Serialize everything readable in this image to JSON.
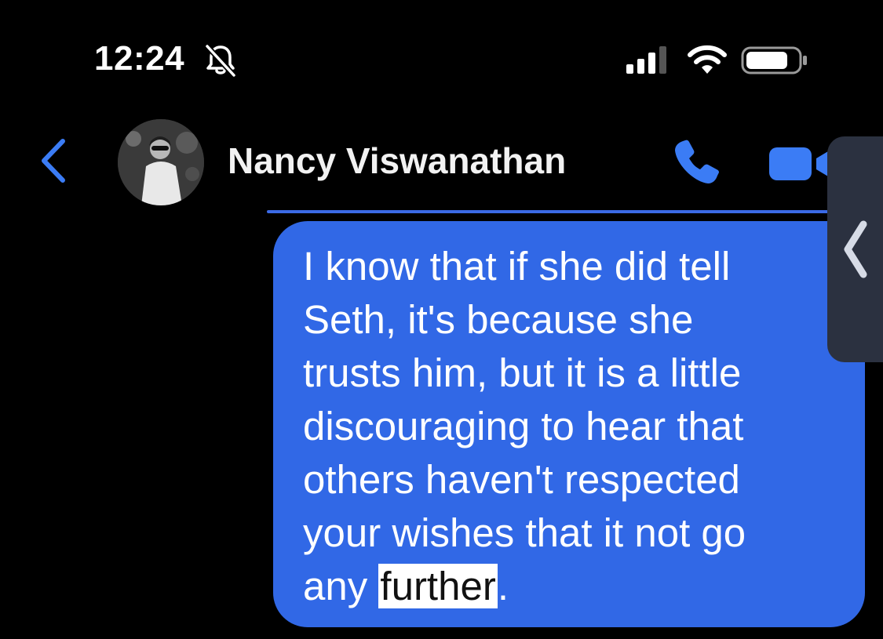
{
  "status_bar": {
    "time": "12:24",
    "bell_icon": "bell-slash-icon",
    "signal_icon": "cellular-signal-icon",
    "wifi_icon": "wifi-icon",
    "battery_icon": "battery-icon"
  },
  "header": {
    "back_icon": "chevron-left-icon",
    "contact_name": "Nancy Viswanathan",
    "phone_icon": "phone-icon",
    "video_icon": "video-camera-icon"
  },
  "message": {
    "text_before": "I know that if she did tell\nSeth, it's because she\ntrusts him, but it is a little\ndiscouraging to hear that\nothers haven't respected\nyour wishes that it not go\nany ",
    "highlighted": "further",
    "text_after": "."
  },
  "side_handle": {
    "icon": "chevron-left-icon"
  },
  "colors": {
    "accent": "#3b7cf5",
    "bubble": "#3168e6",
    "background": "#000000"
  }
}
